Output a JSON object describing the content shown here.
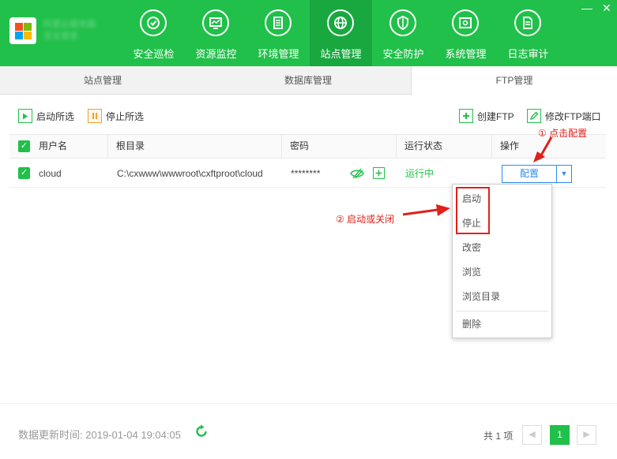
{
  "app": {
    "brand_line1": "阿里云服务器",
    "brand_line2": "安全管家"
  },
  "window_controls": {
    "minimize": "—",
    "close": "✕"
  },
  "nav": [
    {
      "label": "安全巡检",
      "icon": "patrol-icon"
    },
    {
      "label": "资源监控",
      "icon": "monitor-icon"
    },
    {
      "label": "环境管理",
      "icon": "environment-icon"
    },
    {
      "label": "站点管理",
      "icon": "globe-icon",
      "active": true
    },
    {
      "label": "安全防护",
      "icon": "shield-icon"
    },
    {
      "label": "系统管理",
      "icon": "system-icon"
    },
    {
      "label": "日志审计",
      "icon": "log-icon"
    }
  ],
  "subtabs": [
    {
      "label": "站点管理"
    },
    {
      "label": "数据库管理"
    },
    {
      "label": "FTP管理",
      "active": true
    }
  ],
  "toolbar": {
    "start_selected": "启动所选",
    "stop_selected": "停止所选",
    "create_ftp": "创建FTP",
    "modify_port": "修改FTP端口"
  },
  "table": {
    "headers": {
      "username": "用户名",
      "root": "根目录",
      "password": "密码",
      "status": "运行状态",
      "action": "操作"
    },
    "rows": [
      {
        "username": "cloud",
        "root": "C:\\cxwww\\wwwroot\\cxftproot\\cloud",
        "password": "********",
        "status": "运行中",
        "action_button": "配置"
      }
    ]
  },
  "menu": {
    "items": [
      "启动",
      "停止",
      "改密",
      "浏览",
      "浏览目录",
      "删除"
    ]
  },
  "annotations": {
    "click_config": "① 点击配置",
    "start_or_close": "② 启动或关闭"
  },
  "footer": {
    "updated_label": "数据更新时间:",
    "updated_time": "2019-01-04 19:04:05",
    "total": "共 1 项",
    "current_page": "1",
    "prev": "◀",
    "next": "▶"
  },
  "colors": {
    "brand_green": "#21c04a",
    "active_nav_green": "#18a83f",
    "link_blue": "#2d8cf0",
    "annotation_red": "#e0201b",
    "status_green": "#21c04a"
  }
}
